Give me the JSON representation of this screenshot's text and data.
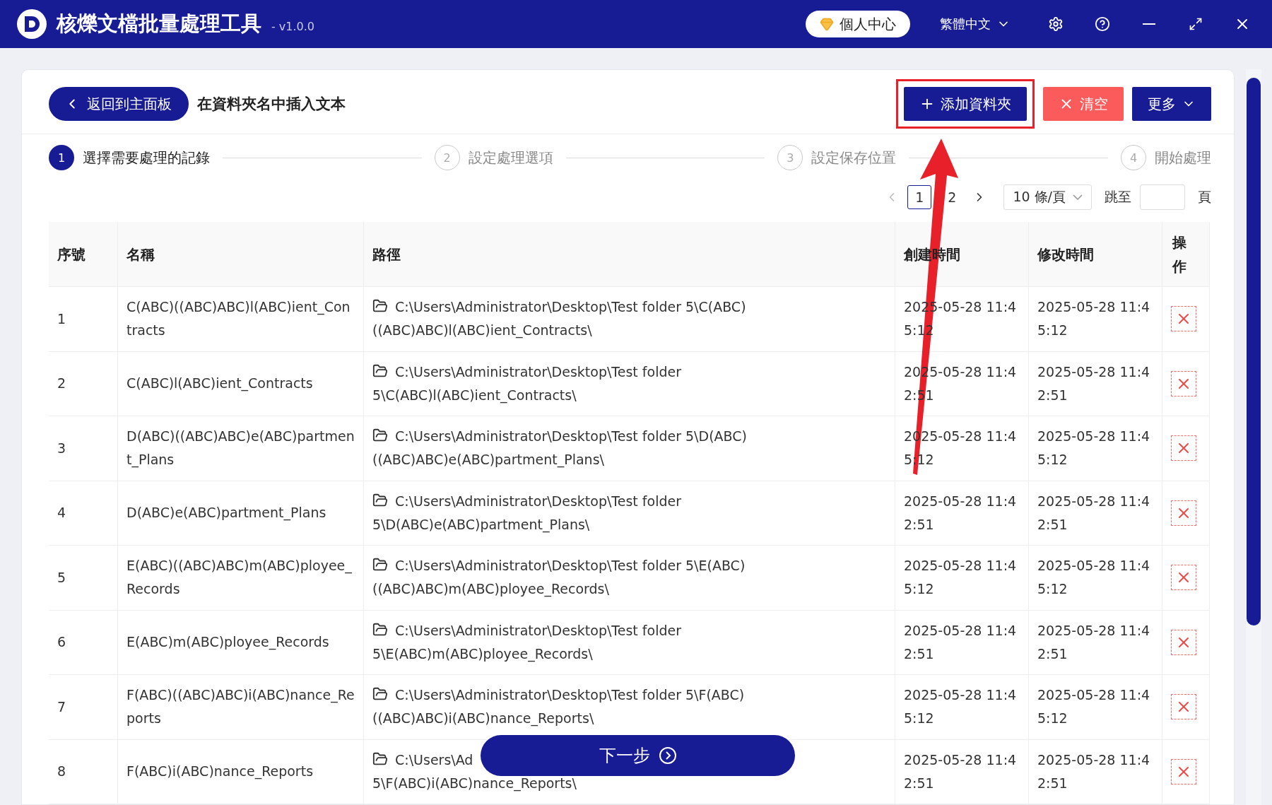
{
  "window": {
    "title": "核爍文檔批量處理工具",
    "version": "- v1.0.0",
    "user_center": "個人中心",
    "language": "繁體中文"
  },
  "header": {
    "back": "返回到主面板",
    "title": "在資料夾名中插入文本",
    "buttons": [
      {
        "kind": "add",
        "label": "添加資料夾",
        "highlighted": true
      },
      {
        "kind": "clear",
        "label": "清空",
        "highlighted": false
      },
      {
        "kind": "more",
        "label": "更多",
        "highlighted": false
      }
    ]
  },
  "steps": [
    {
      "number": "1",
      "label": "選擇需要處理的記錄",
      "selected": true
    },
    {
      "number": "2",
      "label": "設定處理選項",
      "selected": false
    },
    {
      "number": "3",
      "label": "設定保存位置",
      "selected": false
    },
    {
      "number": "4",
      "label": "開始處理",
      "selected": false
    }
  ],
  "pagination": {
    "pages": [
      {
        "label": "1",
        "selected": true
      },
      {
        "label": "2",
        "selected": false
      }
    ],
    "page_size": "10 條/頁",
    "jump_label": "跳至",
    "page_unit": "頁"
  },
  "table": {
    "columns": [
      "序號",
      "名稱",
      "路徑",
      "創建時間",
      "修改時間",
      "操作"
    ],
    "rows": [
      {
        "index": "1",
        "name": "C(ABC)((ABC)ABC)l(ABC)ient_Contracts",
        "path": "C:\\Users\\Administrator\\Desktop\\Test folder 5\\C(ABC)((ABC)ABC)l(ABC)ient_Contracts\\",
        "created": "2025-05-28 11:45:12",
        "modified": "2025-05-28 11:45:12"
      },
      {
        "index": "2",
        "name": "C(ABC)l(ABC)ient_Contracts",
        "path": "C:\\Users\\Administrator\\Desktop\\Test folder 5\\C(ABC)l(ABC)ient_Contracts\\",
        "created": "2025-05-28 11:42:51",
        "modified": "2025-05-28 11:42:51"
      },
      {
        "index": "3",
        "name": "D(ABC)((ABC)ABC)e(ABC)partment_Plans",
        "path": "C:\\Users\\Administrator\\Desktop\\Test folder 5\\D(ABC)((ABC)ABC)e(ABC)partment_Plans\\",
        "created": "2025-05-28 11:45:12",
        "modified": "2025-05-28 11:45:12"
      },
      {
        "index": "4",
        "name": "D(ABC)e(ABC)partment_Plans",
        "path": "C:\\Users\\Administrator\\Desktop\\Test folder 5\\D(ABC)e(ABC)partment_Plans\\",
        "created": "2025-05-28 11:42:51",
        "modified": "2025-05-28 11:42:51"
      },
      {
        "index": "5",
        "name": "E(ABC)((ABC)ABC)m(ABC)ployee_Records",
        "path": "C:\\Users\\Administrator\\Desktop\\Test folder 5\\E(ABC)((ABC)ABC)m(ABC)ployee_Records\\",
        "created": "2025-05-28 11:45:12",
        "modified": "2025-05-28 11:45:12"
      },
      {
        "index": "6",
        "name": "E(ABC)m(ABC)ployee_Records",
        "path": "C:\\Users\\Administrator\\Desktop\\Test folder 5\\E(ABC)m(ABC)ployee_Records\\",
        "created": "2025-05-28 11:42:51",
        "modified": "2025-05-28 11:42:51"
      },
      {
        "index": "7",
        "name": "F(ABC)((ABC)ABC)i(ABC)nance_Reports",
        "path": "C:\\Users\\Administrator\\Desktop\\Test folder 5\\F(ABC)((ABC)ABC)i(ABC)nance_Reports\\",
        "created": "2025-05-28 11:45:12",
        "modified": "2025-05-28 11:45:12"
      },
      {
        "index": "8",
        "name": "F(ABC)i(ABC)nance_Reports",
        "path": "C:\\Users\\Ad",
        "path_tail": "5\\F(ABC)i(ABC)nance_Reports\\",
        "created": "2025-05-28 11:42:51",
        "modified": "2025-05-28 11:42:51"
      }
    ]
  },
  "next_button": "下一步"
}
